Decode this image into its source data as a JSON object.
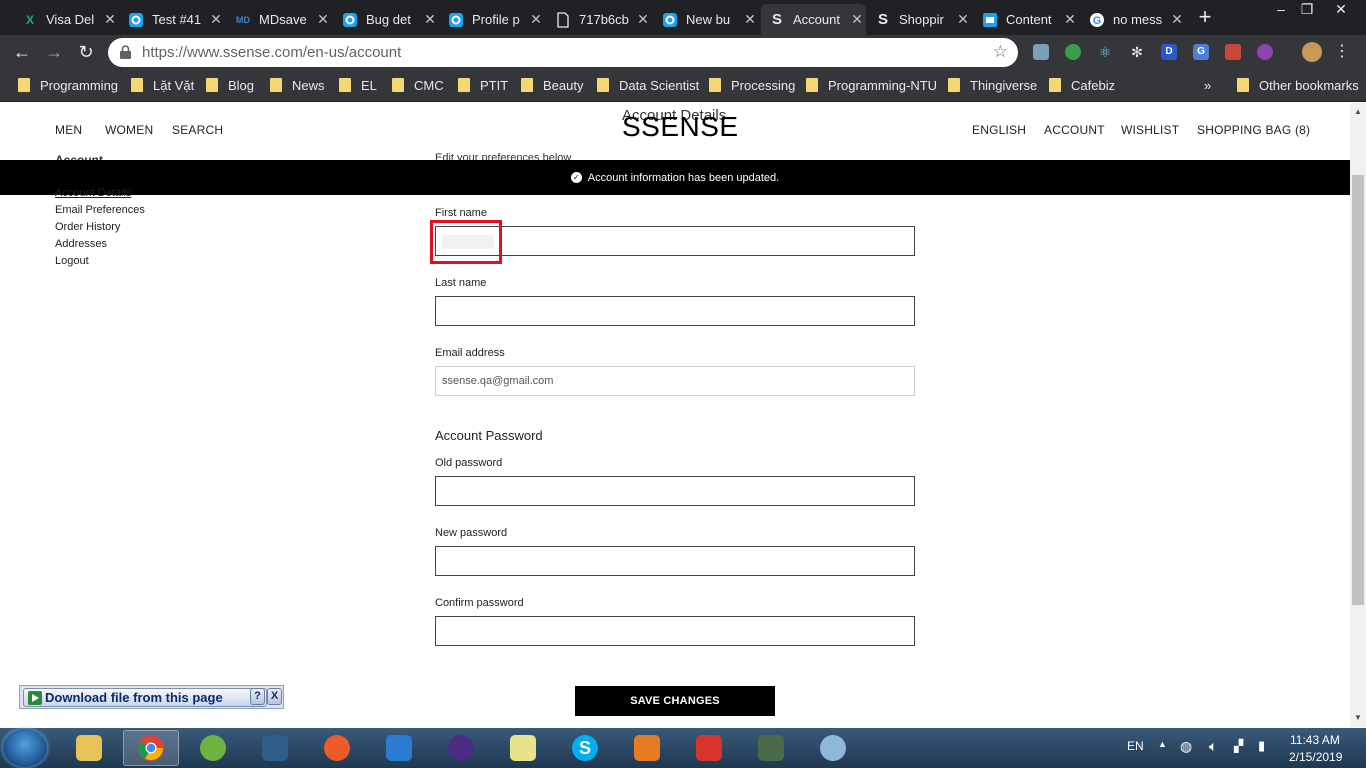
{
  "browser": {
    "tabs": [
      {
        "label": "Visa Del",
        "icon": "x-logo-icon",
        "color": "#2aa198"
      },
      {
        "label": "Test #41",
        "icon": "jira-icon",
        "color": "#1da1f2"
      },
      {
        "label": "MDsave",
        "icon": "mdsave-icon",
        "color": "#3b82c4"
      },
      {
        "label": "Bug det",
        "icon": "jira-icon",
        "color": "#1da1f2"
      },
      {
        "label": "Profile p",
        "icon": "jira-icon",
        "color": "#1da1f2"
      },
      {
        "label": "717b6cb",
        "icon": "document-icon",
        "color": "#e8eaed"
      },
      {
        "label": "New bu",
        "icon": "jira-icon",
        "color": "#1da1f2"
      },
      {
        "label": "Account",
        "icon": "ssense-icon",
        "color": "#e8eaed"
      },
      {
        "label": "Shoppir",
        "icon": "ssense-icon",
        "color": "#e8eaed"
      },
      {
        "label": "Content",
        "icon": "content-icon",
        "color": "#1da1f2"
      },
      {
        "label": "no mess",
        "icon": "google-icon",
        "color": "#4285f4"
      }
    ],
    "active_tab_index": 7,
    "url": "https://www.ssense.com/en-us/account",
    "bookmarks": [
      "Programming",
      "Lặt Vặt",
      "Blog",
      "News",
      "EL",
      "CMC",
      "PTIT",
      "Beauty",
      "Data Scientist",
      "Processing",
      "Programming-NTU",
      "Thingiverse",
      "Cafebiz"
    ],
    "overflow_label": "»",
    "other_bookmarks": "Other bookmarks"
  },
  "site": {
    "logo": "SSENSE",
    "nav_left": [
      "MEN",
      "WOMEN",
      "SEARCH"
    ],
    "nav_right": [
      "ENGLISH",
      "ACCOUNT",
      "WISHLIST",
      "SHOPPING BAG (8)"
    ],
    "page_heading": "Account Details",
    "sidebar_heading": "Account",
    "subheading": "Edit your preferences below",
    "banner": "Account information has been updated.",
    "sidebar": [
      "Account Details",
      "Email Preferences",
      "Order History",
      "Addresses",
      "Logout"
    ],
    "form": {
      "first_name_label": "First name",
      "first_name_value": "",
      "last_name_label": "Last name",
      "last_name_value": "",
      "email_label": "Email address",
      "email_value": "ssense.qa@gmail.com",
      "password_section": "Account Password",
      "old_password_label": "Old password",
      "new_password_label": "New password",
      "confirm_password_label": "Confirm password",
      "save_label": "SAVE CHANGES"
    }
  },
  "download_bar": {
    "label": "Download file from this page",
    "help": "?",
    "close": "X"
  },
  "taskbar": {
    "language": "EN",
    "time": "11:43 AM",
    "date": "2/15/2019"
  }
}
